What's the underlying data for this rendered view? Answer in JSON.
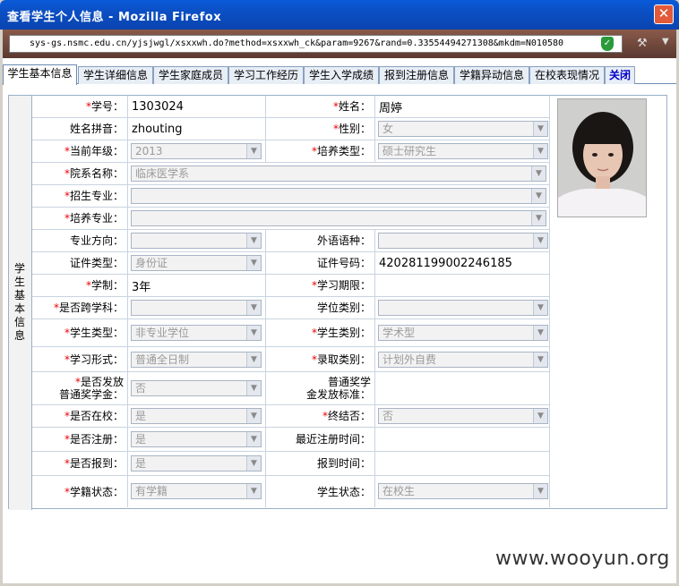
{
  "window": {
    "title": "查看学生个人信息 - Mozilla Firefox",
    "close_label": "✕"
  },
  "url": "sys-gs.nsmc.edu.cn/yjsjwgl/xsxxwh.do?method=xsxxwh_ck&param=9267&rand=0.33554494271308&mkdm=N010580",
  "tabs": [
    "学生基本信息",
    "学生详细信息",
    "学生家庭成员",
    "学习工作经历",
    "学生入学成绩",
    "报到注册信息",
    "学籍异动信息",
    "在校表现情况",
    "关闭"
  ],
  "side_label": "学生基本信息",
  "fields": {
    "xuehao_l": "学号：",
    "xuehao": "1303024",
    "xingming_l": "姓名：",
    "xingming": "周婷",
    "pinyin_l": "姓名拼音：",
    "pinyin": "zhouting",
    "xingbie_l": "性别：",
    "xingbie": "女",
    "nianji_l": "当前年级：",
    "nianji": "2013",
    "peiyang_l": "培养类型：",
    "peiyang": "硕士研究生",
    "yuanxi_l": "院系名称：",
    "yuanxi": "临床医学系",
    "zhaosheng_l": "招生专业：",
    "zhaosheng": "",
    "peiyangzy_l": "培养专业：",
    "peiyangzy": "",
    "fangxiang_l": "专业方向：",
    "fangxiang": "",
    "waiyu_l": "外语语种：",
    "waiyu": "",
    "zjlx_l": "证件类型：",
    "zjlx": "身份证",
    "zjhm_l": "证件号码：",
    "zjhm": "420281199002246185",
    "xuezhi_l": "学制：",
    "xuezhi": "3年",
    "qixian_l": "学习期限：",
    "qixian": "",
    "kuaxueke_l": "是否跨学科：",
    "kuaxueke": "",
    "xuewei_l": "学位类别：",
    "xuewei": "",
    "xslx_l": "学生类型：",
    "xslx": "非专业学位",
    "xslb_l": "学生类别：",
    "xslb": "学术型",
    "xxxs_l": "学习形式：",
    "xxxs": "普通全日制",
    "lqlb_l": "录取类别：",
    "lqlb": "计划外自费",
    "ffjxj_l1": "是否发放",
    "ffjxj_l2": "普通奖学金：",
    "ffjxj": "否",
    "jxjbz_l1": "普通奖学",
    "jxjbz_l2": "金发放标准：",
    "zaixiao_l": "是否在校：",
    "zaixiao": "是",
    "zhongjie_l": "终结否：",
    "zhongjie": "否",
    "zhuce_l": "是否注册：",
    "zhuce": "是",
    "zjzcsj_l": "最近注册时间：",
    "baodao_l": "是否报到：",
    "baodao": "是",
    "bdsj_l": "报到时间：",
    "xjzt_l": "学籍状态：",
    "xjzt": "有学籍",
    "xszt_l": "学生状态：",
    "xszt": "在校生"
  },
  "watermark": "www.wooyun.org"
}
